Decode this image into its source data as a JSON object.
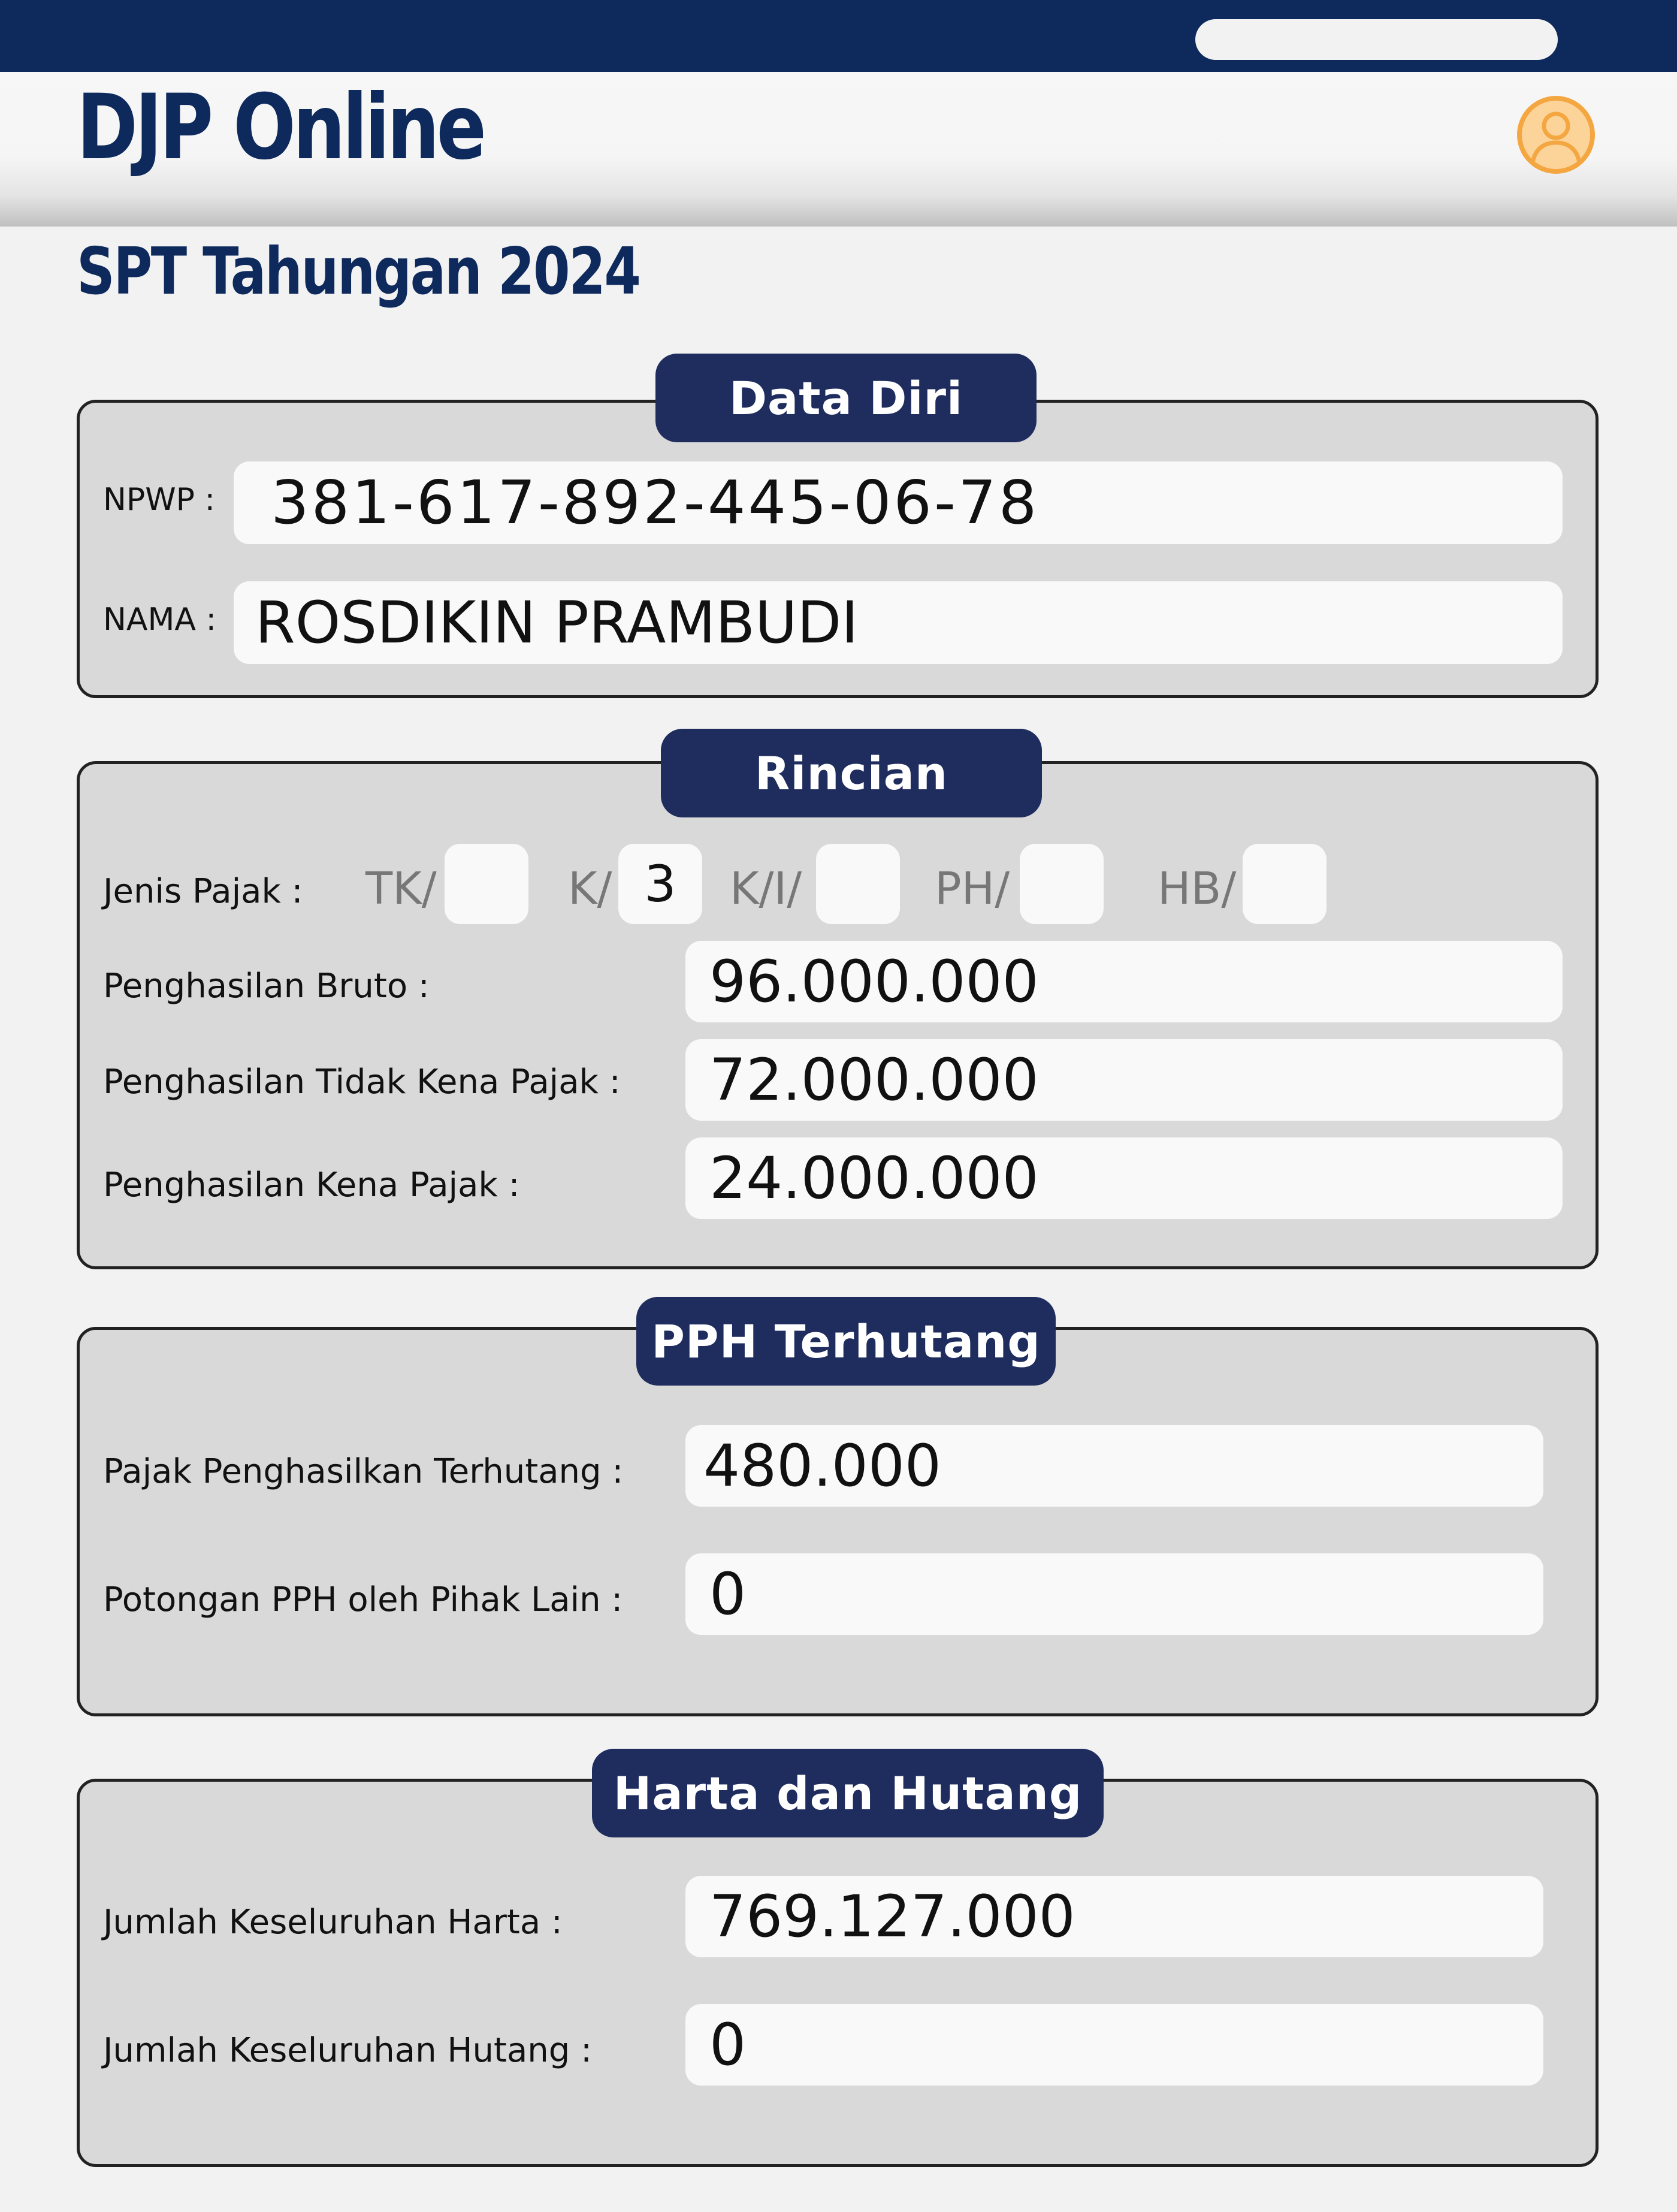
{
  "app": {
    "title": "DJP Online",
    "subtitle": "SPT Tahungan 2024"
  },
  "icons": {
    "profile": "user-circle-icon"
  },
  "colors": {
    "brand_navy": "#0e2a5c",
    "pill_navy": "#1f2c5e",
    "avatar_fill": "#fcd49a",
    "avatar_stroke": "#f4a640"
  },
  "data_diri": {
    "title": "Data Diri",
    "npwp_label": "NPWP :",
    "npwp_value": "381-617-892-445-06-78",
    "nama_label": "NAMA :",
    "nama_value": "ROSDIKIN PRAMBUDI"
  },
  "rincian": {
    "title": "Rincian",
    "jenis_pajak_label": "Jenis Pajak :",
    "jenis_pajak_options": [
      {
        "code": "TK/",
        "value": ""
      },
      {
        "code": "K/",
        "value": "3"
      },
      {
        "code": "K/I/",
        "value": ""
      },
      {
        "code": "PH/",
        "value": ""
      },
      {
        "code": "HB/",
        "value": ""
      }
    ],
    "bruto_label": "Penghasilan Bruto :",
    "bruto_value": "96.000.000",
    "ptkp_label": "Penghasilan Tidak Kena Pajak :",
    "ptkp_value": "72.000.000",
    "pkp_label": "Penghasilan Kena Pajak :",
    "pkp_value": "24.000.000"
  },
  "pph": {
    "title": "PPH Terhutang",
    "terhutang_label": "Pajak Penghasilkan Terhutang :",
    "terhutang_value": "480.000",
    "potongan_label": "Potongan PPH oleh Pihak Lain :",
    "potongan_value": "0"
  },
  "harta": {
    "title": "Harta dan Hutang",
    "harta_label": "Jumlah Keseluruhan Harta :",
    "harta_value": "769.127.000",
    "hutang_label": "Jumlah Keseluruhan Hutang :",
    "hutang_value": "0"
  }
}
